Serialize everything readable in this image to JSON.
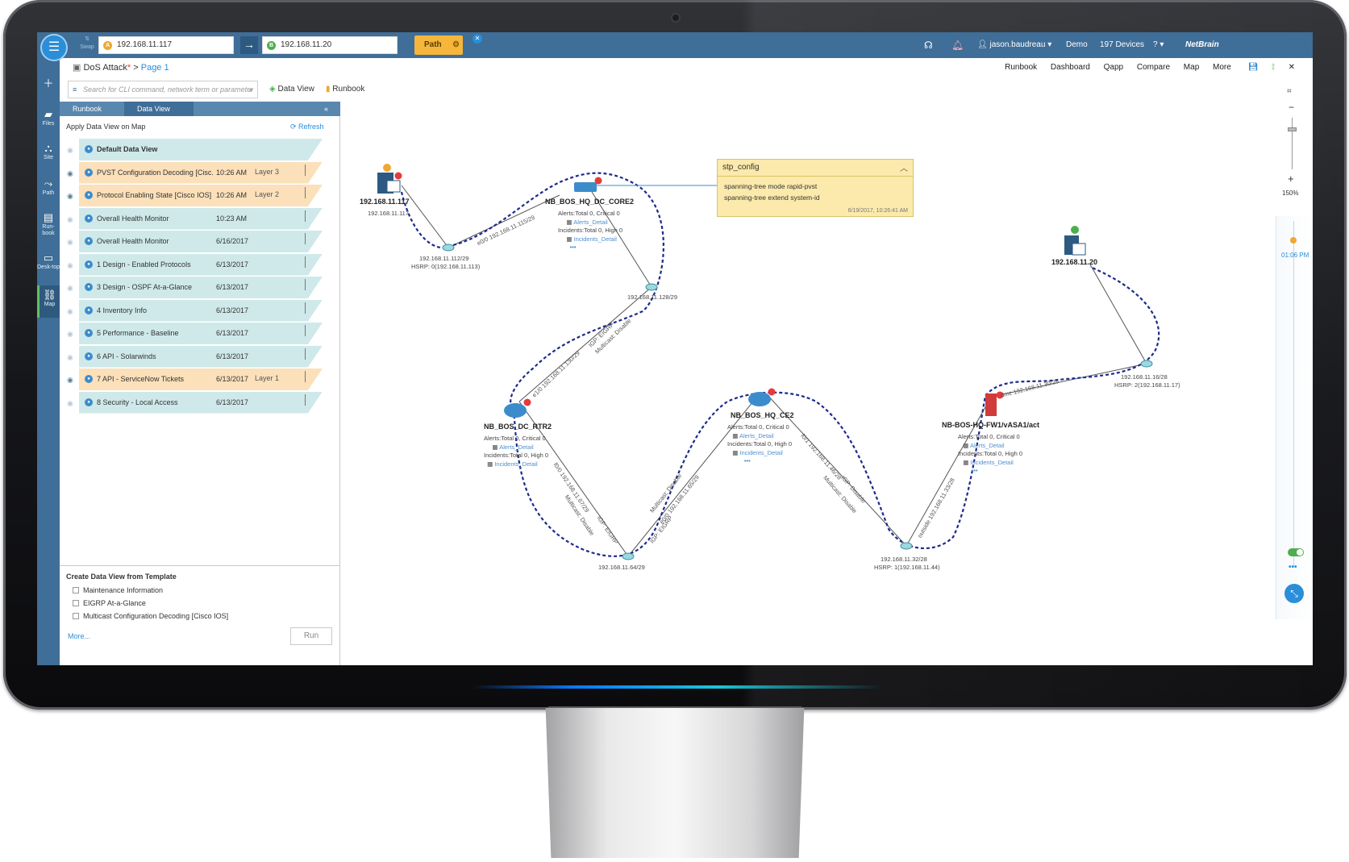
{
  "app": {
    "swap_label": "Swap",
    "source_ip": "192.168.11.117",
    "source_badge": "A",
    "dest_ip": "192.168.11.20",
    "dest_badge": "B",
    "path_label": "Path",
    "user": "jason.baudreau",
    "domain": "Demo",
    "devices": "197 Devices",
    "help": "?",
    "brand": "NetBrain"
  },
  "rail": [
    {
      "label": "Files"
    },
    {
      "label": "Site"
    },
    {
      "label": "Path"
    },
    {
      "label": "Run-book"
    },
    {
      "label": "Desk-top"
    },
    {
      "label": "Map"
    }
  ],
  "breadcrumb": {
    "doc": "DoS Attack",
    "star": "*",
    "sep": ">",
    "page": "Page 1"
  },
  "toplinks": [
    "Runbook",
    "Dashboard",
    "Qapp",
    "Compare",
    "Map",
    "More"
  ],
  "search": {
    "placeholder": "Search for CLI command, network term or parameter"
  },
  "tools": {
    "dataview": "Data View",
    "runbook": "Runbook"
  },
  "panel": {
    "tab_runbook": "Runbook",
    "tab_dataview": "Data View",
    "apply_title": "Apply Data View on Map",
    "refresh": "Refresh",
    "rows": [
      {
        "name": "Default Data View",
        "time": "",
        "layer": "",
        "eye": false,
        "dot": "B",
        "type": "default"
      },
      {
        "name": "PVST Configuration Decoding [Cisc...",
        "time": "10:26 AM",
        "layer": "Layer 3",
        "eye": true,
        "dot": "A",
        "type": "layer"
      },
      {
        "name": "Protocol Enabling State [Cisco IOS]",
        "time": "10:26 AM",
        "layer": "Layer 2",
        "eye": true,
        "dot": "A",
        "type": "layer"
      },
      {
        "name": "Overall Health Monitor",
        "time": "10:23 AM",
        "layer": "",
        "eye": false,
        "dot": "A",
        "type": "normal"
      },
      {
        "name": "Overall Health Monitor",
        "time": "6/16/2017",
        "layer": "",
        "eye": false,
        "dot": "A",
        "type": "normal"
      },
      {
        "name": "1 Design - Enabled Protocols",
        "time": "6/13/2017",
        "layer": "",
        "eye": false,
        "dot": "G",
        "type": "normal"
      },
      {
        "name": "3 Design - OSPF At-a-Glance",
        "time": "6/13/2017",
        "layer": "",
        "eye": false,
        "dot": "G",
        "type": "normal"
      },
      {
        "name": "4 Inventory Info",
        "time": "6/13/2017",
        "layer": "",
        "eye": false,
        "dot": "G",
        "type": "normal"
      },
      {
        "name": "5 Performance - Baseline",
        "time": "6/13/2017",
        "layer": "",
        "eye": false,
        "dot": "G",
        "type": "normal"
      },
      {
        "name": "6 API - Solarwinds",
        "time": "6/13/2017",
        "layer": "",
        "eye": false,
        "dot": "G",
        "type": "normal"
      },
      {
        "name": "7 API - ServiceNow Tickets",
        "time": "6/13/2017",
        "layer": "Layer 1",
        "eye": true,
        "dot": "G",
        "type": "layer"
      },
      {
        "name": "8 Security - Local Access",
        "time": "6/13/2017",
        "layer": "",
        "eye": false,
        "dot": "G",
        "type": "normal"
      }
    ],
    "template_title": "Create Data View from Template",
    "templates": [
      "Maintenance Information",
      "EIGRP At-a-Glance",
      "Multicast Configuration Decoding [Cisco IOS]"
    ],
    "more": "More...",
    "run": "Run"
  },
  "map": {
    "host_a": {
      "name": "192.168.11.117",
      "ip": "192.168.11.117",
      "badge": "A"
    },
    "host_b": {
      "name": "192.168.11.20",
      "badge": "B"
    },
    "core2": {
      "name": "NB_BOS_HQ_DC_CORE2",
      "alerts": "Alerts:Total 0, Critical 0",
      "alerts_link": "Alerts_Detail",
      "incidents": "Incidents:Total 0, High 0",
      "incidents_link": "Incidents_Detail"
    },
    "rtr2": {
      "name": "NB_BOS_DC_RTR2",
      "alerts": "Alerts:Total 0, Critical 0",
      "alerts_link": "Alerts_Detail",
      "incidents": "Incidents:Total 0, High 0",
      "incidents_link": "Incidents_Detail"
    },
    "ce2": {
      "name": "NB_BOS_HQ_CE2",
      "alerts": "Alerts:Total 0, Critical 0",
      "alerts_link": "Alerts_Detail",
      "incidents": "Incidents:Total 0, High 0",
      "incidents_link": "Incidents_Detail"
    },
    "fw1": {
      "name": "NB-BOS-HQ-FW1/vASA1/act",
      "alerts": "Alerts:Total 0, Critical 0",
      "alerts_link": "Alerts_Detail",
      "incidents": "Incidents:Total 0, High 0",
      "incidents_link": "Incidents_Detail"
    },
    "subnets": {
      "s112": "192.168.11.112/29",
      "s112_hsrp": "HSRP: 0(192.168.11.113)",
      "s128": "192.168.11.128/29",
      "s64": "192.168.11.64/29",
      "s32": "192.168.11.32/28",
      "s32_hsrp": "HSRP: 1(192.168.11.44)",
      "s16": "192.168.11.16/28",
      "s16_hsrp": "HSRP: 2(192.168.11.17)"
    },
    "links": {
      "l1": "e0/0 192.168.11.115/29",
      "l2": "e1/0 192.168.11.130/29",
      "l2b": "IGP: EIGRP",
      "l2c": "Multicast: Disable",
      "l3": "f0/0 192.168.11.67/29",
      "l3b": "Multicast: Disable",
      "l3c": "IGP: EIGRP",
      "l4": "e0/0 192.168.11.65/29",
      "l4b": "Multicast: Disable",
      "l4c": "IGP: EIGRP",
      "l5": "f0/1 192.168.11.46/28",
      "l5b": "Multicast: Disable",
      "l5c": "IGP: Disable",
      "l6": "outside 192.168.11.33/28",
      "l7": "dmz 192.168.11.30/28"
    },
    "note": {
      "title": "stp_config",
      "line1": "spanning-tree mode rapid-pvst",
      "line2": "spanning-tree extend system-id",
      "time": "6/19/2017, 10:26:41 AM"
    },
    "zoom_level": "150%",
    "timeline_time": "01:06 PM",
    "colors": {
      "path": "#1d2a8c",
      "accent": "#3f6e98",
      "note": "#fbeaab"
    }
  }
}
